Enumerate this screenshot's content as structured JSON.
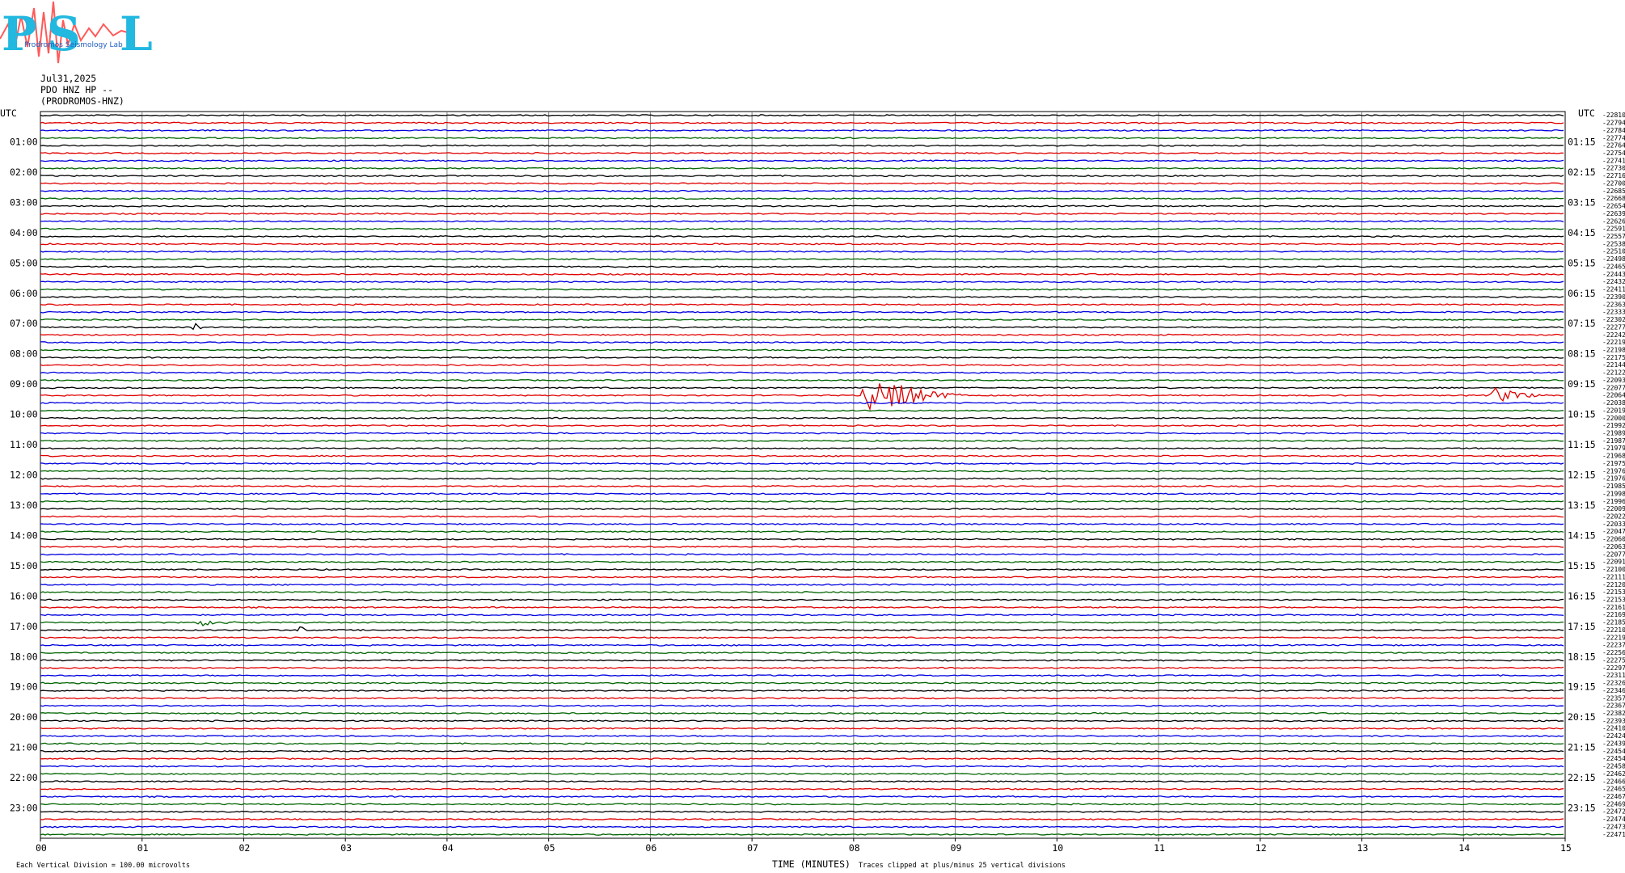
{
  "header": {
    "logo_text": "PSL",
    "logo_small_text": "Prodromos Seismology Lab",
    "date": "Jul31,2025",
    "station": "PDO HNZ HP --",
    "location": "(PRODROMOS-HNZ)"
  },
  "chart_data": {
    "type": "line",
    "title": "",
    "xlabel": "TIME (MINUTES)",
    "ylabel": "",
    "x_ticks": [
      "00",
      "01",
      "02",
      "03",
      "04",
      "05",
      "06",
      "07",
      "08",
      "09",
      "10",
      "11",
      "12",
      "13",
      "14",
      "15"
    ],
    "xlim": [
      0,
      15
    ],
    "left_axis_label": "UTC",
    "right_axis_label": "UTC",
    "left_hour_labels": [
      "01:00",
      "02:00",
      "03:00",
      "04:00",
      "05:00",
      "06:00",
      "07:00",
      "08:00",
      "09:00",
      "10:00",
      "11:00",
      "12:00",
      "13:00",
      "14:00",
      "15:00",
      "16:00",
      "17:00",
      "18:00",
      "19:00",
      "20:00",
      "21:00",
      "22:00",
      "23:00"
    ],
    "right_hour_labels": [
      "01:15",
      "02:15",
      "03:15",
      "04:15",
      "05:15",
      "06:15",
      "07:15",
      "08:15",
      "09:15",
      "10:15",
      "11:15",
      "12:15",
      "13:15",
      "14:15",
      "15:15",
      "16:15",
      "17:15",
      "18:15",
      "19:15",
      "20:15",
      "21:15",
      "22:15",
      "23:15"
    ],
    "trace_colors": [
      "#000000",
      "#e00000",
      "#0000e0",
      "#006400"
    ],
    "trace_count": 96,
    "trace_counts": [
      -22810,
      -22794,
      -22784,
      -22774,
      -22764,
      -22754,
      -22741,
      -22730,
      -22716,
      -22700,
      -22685,
      -22668,
      -22654,
      -22639,
      -22626,
      -22591,
      -22557,
      -22538,
      -22510,
      -22498,
      -22465,
      -22443,
      -22432,
      -22411,
      -22390,
      -22363,
      -22333,
      -22302,
      -22277,
      -22242,
      -22219,
      -22198,
      -22175,
      -22144,
      -22122,
      -22093,
      -22077,
      -22064,
      -22038,
      -22019,
      -22000,
      -21992,
      -21989,
      -21987,
      -21979,
      -21968,
      -21975,
      -21976,
      -21976,
      -21985,
      -21998,
      -21996,
      -22009,
      -22022,
      -22033,
      -22047,
      -22060,
      -22063,
      -22077,
      -22091,
      -22100,
      -22111,
      -22120,
      -22153,
      -22153,
      -22161,
      -22169,
      -22185,
      -22210,
      -22219,
      -22237,
      -22256,
      -22275,
      -22297,
      -22311,
      -22326,
      -22346,
      -22357,
      -22367,
      -22382,
      -22393,
      -22410,
      -22424,
      -22439,
      -22454,
      -22454,
      -22458,
      -22462,
      -22466,
      -22465,
      -22467,
      -22469,
      -22472,
      -22474,
      -22473,
      -22471
    ],
    "events": [
      {
        "trace": 37,
        "minute": 8.15,
        "amplitude": 8,
        "duration_min": 0.9
      },
      {
        "trace": 37,
        "minute": 14.3,
        "amplitude": 3,
        "duration_min": 0.5
      },
      {
        "trace": 28,
        "minute": 1.55,
        "amplitude": 1.5,
        "duration_min": 0.15
      },
      {
        "trace": 67,
        "minute": 1.6,
        "amplitude": 1.0,
        "duration_min": 0.4
      },
      {
        "trace": 68,
        "minute": 2.55,
        "amplitude": 1.0,
        "duration_min": 0.2
      }
    ],
    "footer_left": "Each Vertical Division =  100.00 microvolts",
    "footer_note": "Traces clipped at plus/minus 25 vertical divisions"
  }
}
